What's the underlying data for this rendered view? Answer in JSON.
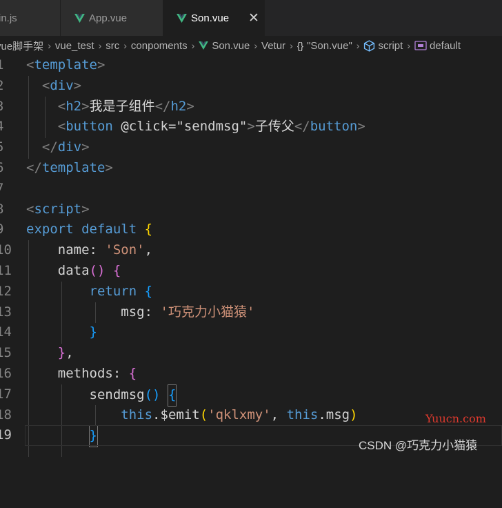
{
  "tabs": [
    {
      "label": "in.js"
    },
    {
      "label": "App.vue"
    },
    {
      "label": "Son.vue",
      "close": "✕"
    }
  ],
  "breadcrumb": {
    "project": "vue脚手架",
    "folder1": "vue_test",
    "folder2": "src",
    "folder3": "conpoments",
    "file": "Son.vue",
    "service": "Vetur",
    "symbol1": "\"Son.vue\"",
    "symbol1_icon": "{}",
    "symbol2": "script",
    "symbol3": "default"
  },
  "code": {
    "line_numbers": [
      "1",
      "2",
      "3",
      "4",
      "5",
      "6",
      "7",
      "8",
      "9",
      "10",
      "11",
      "12",
      "13",
      "14",
      "15",
      "16",
      "17",
      "18",
      "19"
    ],
    "l1_tag": "template",
    "l2_tag": "div",
    "l3_tag": "h2",
    "l3_text": "我是子组件",
    "l4_tag": "button",
    "l4_attr": "@click",
    "l4_value": "\"sendmsg\"",
    "l4_text": "子传父",
    "l5_tag": "div",
    "l6_tag": "template",
    "l8_tag": "script",
    "l9_kw1": "export",
    "l9_kw2": "default",
    "l10_key": "name",
    "l10_value": "'Son'",
    "l11_fn": "data",
    "l12_kw": "return",
    "l13_key": "msg",
    "l13_value": "'巧克力小猫猿'",
    "l16_key": "methods",
    "l17_fn": "sendmsg",
    "l18_this1": "this",
    "l18_emit": "$emit",
    "l18_arg": "'qklxmy'",
    "l18_this2": "this",
    "l18_prop": "msg"
  },
  "watermark": {
    "site": "Yuucn.com",
    "author": "CSDN @巧克力小猫猿"
  },
  "colors": {
    "background": "#1e1e1e",
    "tag": "#569cd6",
    "string": "#ce9178",
    "vue_green": "#41b883"
  }
}
